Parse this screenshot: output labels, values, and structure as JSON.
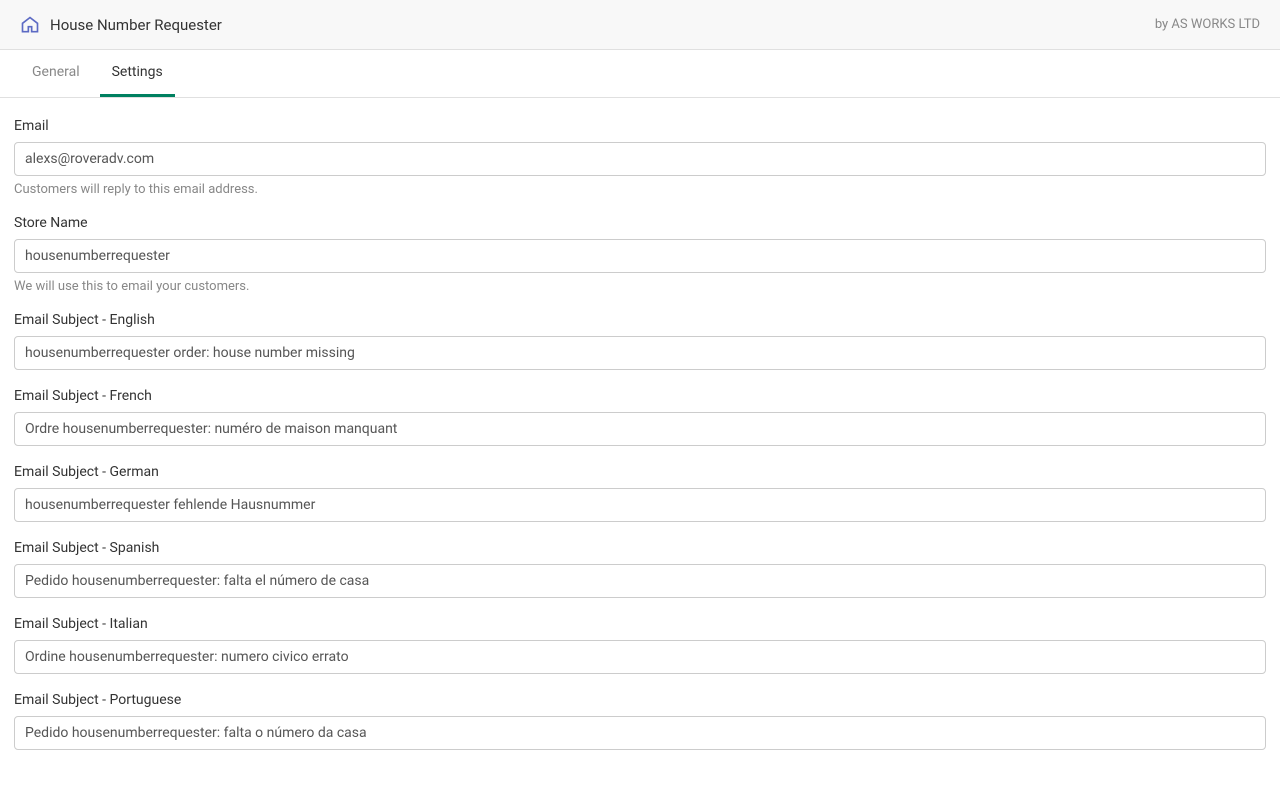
{
  "header": {
    "title": "House Number Requester",
    "author": "by AS WORKS LTD"
  },
  "tabs": {
    "general": "General",
    "settings": "Settings"
  },
  "form": {
    "email": {
      "label": "Email",
      "value": "alexs@roveradv.com",
      "help": "Customers will reply to this email address."
    },
    "storeName": {
      "label": "Store Name",
      "value": "housenumberrequester",
      "help": "We will use this to email your customers."
    },
    "subjectEnglish": {
      "label": "Email Subject - English",
      "value": "housenumberrequester order: house number missing"
    },
    "subjectFrench": {
      "label": "Email Subject - French",
      "value": "Ordre housenumberrequester: numéro de maison manquant"
    },
    "subjectGerman": {
      "label": "Email Subject - German",
      "value": "housenumberrequester fehlende Hausnummer"
    },
    "subjectSpanish": {
      "label": "Email Subject - Spanish",
      "value": "Pedido housenumberrequester: falta el número de casa"
    },
    "subjectItalian": {
      "label": "Email Subject - Italian",
      "value": "Ordine housenumberrequester: numero civico errato"
    },
    "subjectPortuguese": {
      "label": "Email Subject - Portuguese",
      "value": "Pedido housenumberrequester: falta o número da casa"
    }
  }
}
